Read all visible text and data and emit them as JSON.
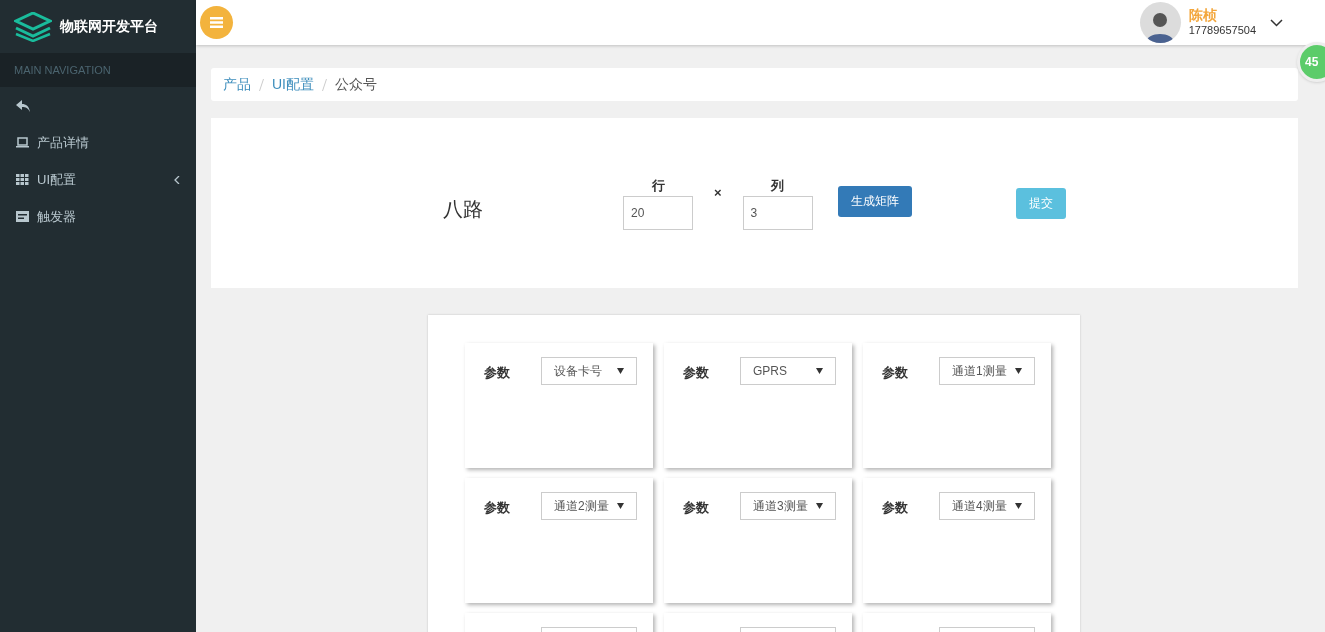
{
  "brand": "物联网开发平台",
  "sidebar": {
    "heading": "MAIN NAVIGATION",
    "items": [
      {
        "kind": "back"
      },
      {
        "kind": "laptop",
        "label": "产品详情",
        "expanded": false
      },
      {
        "kind": "grid",
        "label": "UI配置",
        "expanded": false
      },
      {
        "kind": "card",
        "label": "触发器",
        "expanded": false
      }
    ]
  },
  "user": {
    "name": "陈桢",
    "phone": "17789657504"
  },
  "floating_badge": "45",
  "breadcrumb": [
    {
      "label": "产品",
      "link": true
    },
    {
      "label": "UI配置",
      "link": true
    },
    {
      "label": "公众号",
      "link": false
    }
  ],
  "form": {
    "title": "八路",
    "rows_label": "行",
    "rows_value": "20",
    "times": "×",
    "cols_label": "列",
    "cols_value": "3",
    "generate": "生成矩阵",
    "submit": "提交"
  },
  "cards": [
    {
      "kind": "param",
      "label": "参数",
      "value": "设备卡号"
    },
    {
      "kind": "param",
      "label": "参数",
      "value": "GPRS"
    },
    {
      "kind": "param",
      "label": "参数",
      "value": "通道1测量"
    },
    {
      "kind": "param",
      "label": "参数",
      "value": "通道2测量"
    },
    {
      "kind": "param",
      "label": "参数",
      "value": "通道3测量"
    },
    {
      "kind": "param",
      "label": "参数",
      "value": "通道4测量"
    },
    {
      "kind": "blank"
    },
    {
      "kind": "blank"
    },
    {
      "kind": "blank"
    }
  ]
}
